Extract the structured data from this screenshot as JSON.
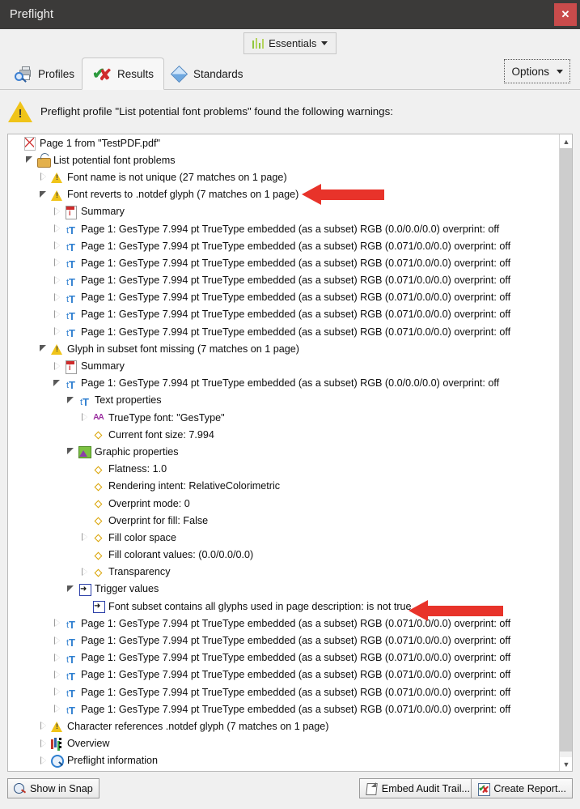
{
  "window": {
    "title": "Preflight",
    "close_label": "✕"
  },
  "toolbar": {
    "essentials_label": "Essentials",
    "essentials_icon": "barchart-icon",
    "caret_icon": "chevron-down-icon"
  },
  "tabs": [
    {
      "label": "Profiles",
      "icon": "printer-search-icon",
      "active": false
    },
    {
      "label": "Results",
      "icon": "check-x-icon",
      "active": true
    },
    {
      "label": "Standards",
      "icon": "diamond-icon",
      "active": false
    }
  ],
  "options_button": {
    "label": "Options",
    "icon": "chevron-down-icon"
  },
  "banner": {
    "icon": "warning-triangle-icon",
    "text": "Preflight profile \"List potential font problems\" found the following warnings:"
  },
  "scrollbar": {
    "up_icon": "chevron-up-icon",
    "down_icon": "chevron-down-icon"
  },
  "tree": [
    {
      "indent": 0,
      "twisty": "none",
      "icon": "pdf-icon",
      "label": "Page 1 from \"TestPDF.pdf\""
    },
    {
      "indent": 1,
      "twisty": "expanded",
      "icon": "profile-icon",
      "label": "List potential font problems"
    },
    {
      "indent": 2,
      "twisty": "collapsed",
      "icon": "warning-small-icon",
      "label": "Font name is not unique (27 matches on 1 page)"
    },
    {
      "indent": 2,
      "twisty": "expanded",
      "icon": "warning-small-icon",
      "label": "Font reverts to .notdef glyph (7 matches on 1 page)"
    },
    {
      "indent": 3,
      "twisty": "collapsed",
      "icon": "summary-icon",
      "label": "Summary"
    },
    {
      "indent": 3,
      "twisty": "collapsed",
      "icon": "text-icon",
      "label": "Page 1: GesType 7.994 pt TrueType  embedded (as a subset) RGB (0.0/0.0/0.0)  overprint: off"
    },
    {
      "indent": 3,
      "twisty": "collapsed",
      "icon": "text-icon",
      "label": "Page 1: GesType 7.994 pt TrueType  embedded (as a subset) RGB (0.071/0.0/0.0)  overprint: off"
    },
    {
      "indent": 3,
      "twisty": "collapsed",
      "icon": "text-icon",
      "label": "Page 1: GesType 7.994 pt TrueType  embedded (as a subset) RGB (0.071/0.0/0.0)  overprint: off"
    },
    {
      "indent": 3,
      "twisty": "collapsed",
      "icon": "text-icon",
      "label": "Page 1: GesType 7.994 pt TrueType  embedded (as a subset) RGB (0.071/0.0/0.0)  overprint: off"
    },
    {
      "indent": 3,
      "twisty": "collapsed",
      "icon": "text-icon",
      "label": "Page 1: GesType 7.994 pt TrueType  embedded (as a subset) RGB (0.071/0.0/0.0)  overprint: off"
    },
    {
      "indent": 3,
      "twisty": "collapsed",
      "icon": "text-icon",
      "label": "Page 1: GesType 7.994 pt TrueType  embedded (as a subset) RGB (0.071/0.0/0.0)  overprint: off"
    },
    {
      "indent": 3,
      "twisty": "collapsed",
      "icon": "text-icon",
      "label": "Page 1: GesType 7.994 pt TrueType  embedded (as a subset) RGB (0.071/0.0/0.0)  overprint: off"
    },
    {
      "indent": 2,
      "twisty": "expanded",
      "icon": "warning-small-icon",
      "label": "Glyph in subset font missing (7 matches on 1 page)"
    },
    {
      "indent": 3,
      "twisty": "collapsed",
      "icon": "summary-icon",
      "label": "Summary"
    },
    {
      "indent": 3,
      "twisty": "expanded",
      "icon": "text-icon",
      "label": "Page 1: GesType 7.994 pt TrueType  embedded (as a subset) RGB (0.0/0.0/0.0)  overprint: off"
    },
    {
      "indent": 4,
      "twisty": "expanded",
      "icon": "text-icon",
      "label": "Text properties"
    },
    {
      "indent": 5,
      "twisty": "collapsed",
      "icon": "truetype-font-icon",
      "label": "TrueType font: \"GesType\""
    },
    {
      "indent": 5,
      "twisty": "none",
      "icon": "property-bullet-icon",
      "label": "Current font size: 7.994"
    },
    {
      "indent": 4,
      "twisty": "expanded",
      "icon": "graphic-properties-icon",
      "label": "Graphic properties"
    },
    {
      "indent": 5,
      "twisty": "none",
      "icon": "property-bullet-icon",
      "label": "Flatness: 1.0"
    },
    {
      "indent": 5,
      "twisty": "none",
      "icon": "property-bullet-icon",
      "label": "Rendering intent: RelativeColorimetric"
    },
    {
      "indent": 5,
      "twisty": "none",
      "icon": "property-bullet-icon",
      "label": "Overprint mode: 0"
    },
    {
      "indent": 5,
      "twisty": "none",
      "icon": "property-bullet-icon",
      "label": "Overprint for fill: False"
    },
    {
      "indent": 5,
      "twisty": "collapsed",
      "icon": "property-bullet-icon",
      "label": "Fill color space"
    },
    {
      "indent": 5,
      "twisty": "none",
      "icon": "property-bullet-icon",
      "label": "Fill colorant values: (0.0/0.0/0.0)"
    },
    {
      "indent": 5,
      "twisty": "collapsed",
      "icon": "property-bullet-icon",
      "label": "Transparency"
    },
    {
      "indent": 4,
      "twisty": "expanded",
      "icon": "trigger-values-icon",
      "label": "Trigger values"
    },
    {
      "indent": 5,
      "twisty": "none",
      "icon": "trigger-item-icon",
      "label": "Font subset contains all glyphs used in page description: is not true"
    },
    {
      "indent": 3,
      "twisty": "collapsed",
      "icon": "text-icon",
      "label": "Page 1: GesType 7.994 pt TrueType  embedded (as a subset) RGB (0.071/0.0/0.0)  overprint: off"
    },
    {
      "indent": 3,
      "twisty": "collapsed",
      "icon": "text-icon",
      "label": "Page 1: GesType 7.994 pt TrueType  embedded (as a subset) RGB (0.071/0.0/0.0)  overprint: off"
    },
    {
      "indent": 3,
      "twisty": "collapsed",
      "icon": "text-icon",
      "label": "Page 1: GesType 7.994 pt TrueType  embedded (as a subset) RGB (0.071/0.0/0.0)  overprint: off"
    },
    {
      "indent": 3,
      "twisty": "collapsed",
      "icon": "text-icon",
      "label": "Page 1: GesType 7.994 pt TrueType  embedded (as a subset) RGB (0.071/0.0/0.0)  overprint: off"
    },
    {
      "indent": 3,
      "twisty": "collapsed",
      "icon": "text-icon",
      "label": "Page 1: GesType 7.994 pt TrueType  embedded (as a subset) RGB (0.071/0.0/0.0)  overprint: off"
    },
    {
      "indent": 3,
      "twisty": "collapsed",
      "icon": "text-icon",
      "label": "Page 1: GesType 7.994 pt TrueType  embedded (as a subset) RGB (0.071/0.0/0.0)  overprint: off"
    },
    {
      "indent": 2,
      "twisty": "collapsed",
      "icon": "warning-small-icon",
      "label": "Character references .notdef glyph (7 matches on 1 page)"
    },
    {
      "indent": 2,
      "twisty": "collapsed",
      "icon": "overview-icon",
      "label": "Overview"
    },
    {
      "indent": 2,
      "twisty": "collapsed",
      "icon": "preflight-info-icon",
      "label": "Preflight information"
    }
  ],
  "annotations": [
    {
      "name": "arrow-font-reverts",
      "color": "#e8332a"
    },
    {
      "name": "arrow-font-subset",
      "color": "#e8332a"
    }
  ],
  "bottom_buttons": [
    {
      "label": "Show in Snap",
      "icon": "snap-icon"
    },
    {
      "label": "Embed Audit Trail...",
      "icon": "document-icon"
    },
    {
      "label": "Create Report...",
      "icon": "report-icon"
    }
  ]
}
